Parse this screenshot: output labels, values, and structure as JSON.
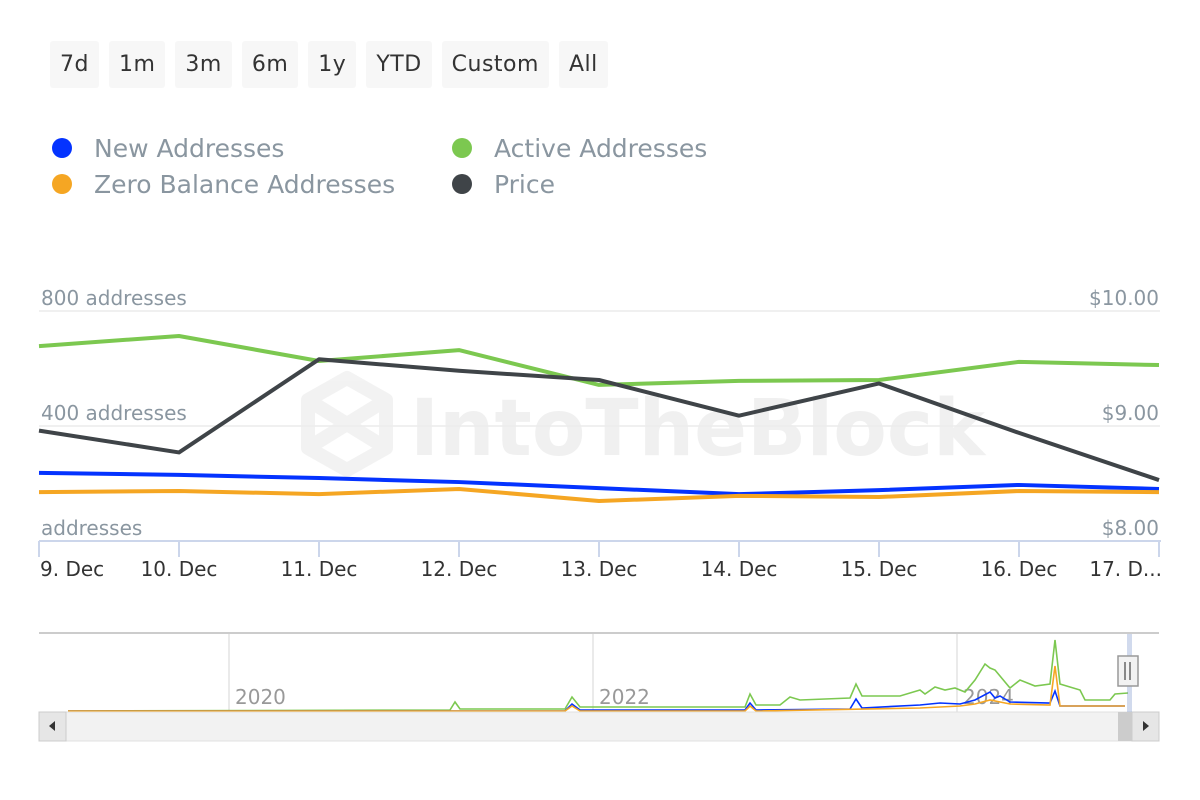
{
  "range_selector": {
    "buttons": [
      "7d",
      "1m",
      "3m",
      "6m",
      "1y",
      "YTD",
      "Custom",
      "All"
    ]
  },
  "legend": [
    {
      "name": "New Addresses",
      "color": "#0433ff"
    },
    {
      "name": "Active Addresses",
      "color": "#7cc850"
    },
    {
      "name": "Zero Balance Addresses",
      "color": "#f5a623"
    },
    {
      "name": "Price",
      "color": "#3f4448"
    }
  ],
  "watermark": "IntoTheBlock",
  "chart_data": {
    "type": "line",
    "title": "",
    "x": [
      "9. Dec",
      "10. Dec",
      "11. Dec",
      "12. Dec",
      "13. Dec",
      "14. Dec",
      "15. Dec",
      "16. Dec",
      "17. D..."
    ],
    "series": [
      {
        "name": "Active Addresses",
        "axis": "left",
        "color": "#7cc850",
        "values": [
          678,
          713,
          626,
          664,
          543,
          557,
          560,
          623,
          612
        ]
      },
      {
        "name": "New Addresses",
        "axis": "left",
        "color": "#0433ff",
        "values": [
          237,
          230,
          219,
          205,
          184,
          163,
          177,
          195,
          181
        ]
      },
      {
        "name": "Zero Balance Addresses",
        "axis": "left",
        "color": "#f5a623",
        "values": [
          170,
          174,
          163,
          181,
          139,
          157,
          153,
          174,
          170
        ]
      },
      {
        "name": "Price",
        "axis": "right",
        "color": "#3f4448",
        "values": [
          8.96,
          8.77,
          9.58,
          9.48,
          9.4,
          9.09,
          9.37,
          8.94,
          8.53
        ]
      }
    ],
    "y_left": {
      "ticks": [
        0,
        400,
        800
      ],
      "tick_labels": [
        "addresses",
        "400 addresses",
        "800 addresses"
      ],
      "range": [
        0,
        800
      ]
    },
    "y_right": {
      "ticks": [
        8,
        9,
        10
      ],
      "tick_labels": [
        "$8.00",
        "$9.00",
        "$10.00"
      ],
      "range": [
        8,
        10
      ]
    },
    "grid": true,
    "legend_position": "top-left",
    "navigator": {
      "year_labels": [
        "2020",
        "2022",
        "2024"
      ],
      "selection": "last 7 days (right edge)"
    }
  }
}
